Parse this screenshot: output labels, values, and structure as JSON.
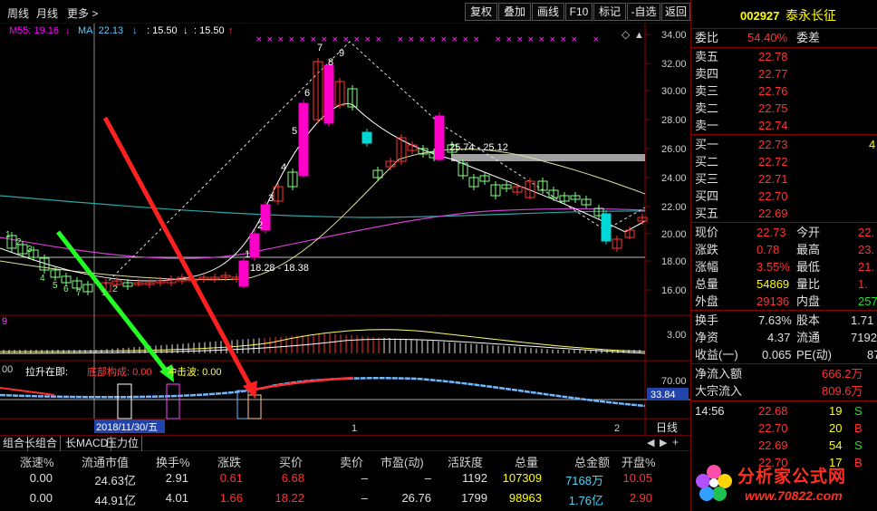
{
  "toolbar": {
    "left": [
      "周线",
      "月线",
      "更多 >"
    ],
    "buttons": [
      "复权",
      "叠加",
      "画线",
      "F10",
      "标记",
      "-自选",
      "返回"
    ]
  },
  "ma_legend": {
    "m55": "M55: 19.16",
    "m_sep": "↓",
    "ma": "MA: 22.13",
    "ma_arrow": "↓",
    "v1": ": 15.50",
    "v1_arrow": "↓",
    "v2": ": 15.50",
    "v2_arrow": "↑"
  },
  "price_axis": [
    "34.00",
    "32.00",
    "30.00",
    "28.00",
    "26.00",
    "24.00",
    "22.00",
    "20.00",
    "18.00",
    "16.00"
  ],
  "chart_annotations": {
    "low_range": "18.28 - 18.38",
    "high_range": "25.74 - 25.12",
    "count_labels": [
      "1",
      "2",
      "3",
      "4",
      "5",
      "6",
      "7",
      "8",
      "9"
    ],
    "low_counts": [
      "1",
      "2",
      "3",
      "4",
      "5",
      "6",
      "7",
      "1",
      "2"
    ],
    "sub_axis": "3.00",
    "current_tag": "33.84",
    "osc_axis": "70.00",
    "date_label": "2018/11/30/五",
    "period_mark1": "1",
    "period_mark2": "2",
    "weekly_label": "日线"
  },
  "indicator_row": {
    "prefix": "00",
    "a": "拉升在即:",
    "b": "底部构成: 0.00",
    "c": "冲击波: 0.00",
    "d": "9"
  },
  "tabs": [
    "组合",
    "长组合",
    "长MACD",
    "压力位"
  ],
  "stock": {
    "code": "002927",
    "name": "泰永长征"
  },
  "orderbook": {
    "wei_label": "委比",
    "wei_value": "54.40%",
    "cha_label": "委差",
    "sells": [
      {
        "label": "卖五",
        "price": "22.78"
      },
      {
        "label": "卖四",
        "price": "22.77"
      },
      {
        "label": "卖三",
        "price": "22.76"
      },
      {
        "label": "卖二",
        "price": "22.75"
      },
      {
        "label": "卖一",
        "price": "22.74"
      }
    ],
    "buys": [
      {
        "label": "买一",
        "price": "22.73",
        "vol": "4"
      },
      {
        "label": "买二",
        "price": "22.72"
      },
      {
        "label": "买三",
        "price": "22.71"
      },
      {
        "label": "买四",
        "price": "22.70"
      },
      {
        "label": "买五",
        "price": "22.69"
      }
    ]
  },
  "quote": [
    {
      "l": "现价",
      "v": "22.73",
      "l2": "今开",
      "v2": "22."
    },
    {
      "l": "涨跌",
      "v": "0.78",
      "l2": "最高",
      "v2": "23."
    },
    {
      "l": "涨幅",
      "v": "3.55%",
      "l2": "最低",
      "v2": "21."
    },
    {
      "l": "总量",
      "v": "54869",
      "l2": "量比",
      "v2": "1."
    },
    {
      "l": "外盘",
      "v": "29136",
      "l2": "内盘",
      "v2": "257"
    }
  ],
  "stats": [
    {
      "l": "换手",
      "v": "7.63%",
      "l2": "股本",
      "v2": "1.71"
    },
    {
      "l": "净资",
      "v": "4.37",
      "l2": "流通",
      "v2": "7192"
    },
    {
      "l": "收益(一)",
      "v": "0.065",
      "l2": "PE(动)",
      "v2": "87"
    }
  ],
  "flows": [
    {
      "l": "净流入额",
      "v": "666.2万"
    },
    {
      "l": "大宗流入",
      "v": "809.6万"
    }
  ],
  "ticks": [
    {
      "t": "14:56",
      "p": "22.68",
      "v": "19",
      "s": "S"
    },
    {
      "t": "",
      "p": "22.70",
      "v": "20",
      "s": "B"
    },
    {
      "t": "",
      "p": "22.69",
      "v": "54",
      "s": "S"
    },
    {
      "t": "",
      "p": "22.70",
      "v": "17",
      "s": "B"
    }
  ],
  "table": {
    "headers": [
      "涨速%",
      "流通市值",
      "换手%",
      "涨跌",
      "买价",
      "卖价",
      "市盈(动)",
      "活跃度",
      "总量",
      "总金额",
      "开盘%"
    ],
    "rows": [
      [
        "0.00",
        "24.63亿",
        "2.91",
        "0.61",
        "6.68",
        "–",
        "–",
        "1192",
        "107309",
        "7168万",
        "10.05"
      ],
      [
        "0.00",
        "44.91亿",
        "4.01",
        "1.66",
        "18.22",
        "–",
        "26.76",
        "1799",
        "98963",
        "1.76亿",
        "2.90"
      ]
    ]
  },
  "logo": {
    "title": "分析家公式网",
    "url": "www.70822.com"
  },
  "colors": {
    "up": "#ff3232",
    "down": "#00d8d8",
    "yellow": "#ffff00",
    "magenta": "#ff00ff"
  }
}
